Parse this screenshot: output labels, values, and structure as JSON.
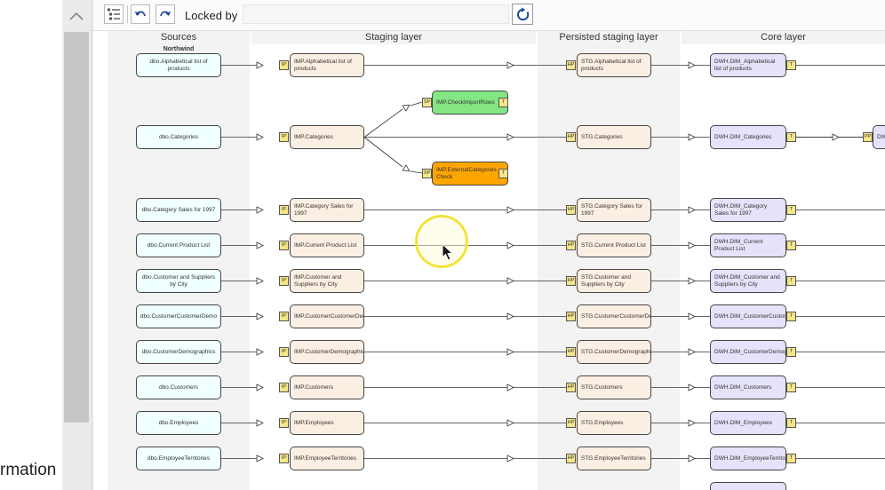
{
  "left_panel": {
    "partial_label": "rmation"
  },
  "toolbar": {
    "locked_label": "Locked by",
    "locked_value": ""
  },
  "columns": [
    {
      "label": "Sources"
    },
    {
      "label": "Staging layer"
    },
    {
      "label": "Persisted staging layer"
    },
    {
      "label": "Core layer"
    }
  ],
  "group_label": "Northwind",
  "rows": [
    {
      "source": "dbo.Alphabetical list of products",
      "imp": "IMP.Alphabetical list of products",
      "stg": "STG.Alphabetical list of products",
      "dwh": "DWH.DIM_Alphabetical list of products"
    },
    {
      "source": "dbo.Categories",
      "imp": "IMP.Categories",
      "stg": "STG.Categories",
      "dwh": "DWH.DIM_Categories"
    },
    {
      "source": "dbo.Category Sales for 1997",
      "imp": "IMP.Category Sales for 1997",
      "stg": "STG.Category Sales for 1997",
      "dwh": "DWH.DIM_Category Sales for 1997"
    },
    {
      "source": "dbo.Current Product List",
      "imp": "IMP.Current Product List",
      "stg": "STG.Current Product List",
      "dwh": "DWH.DIM_Current Product List"
    },
    {
      "source": "dbo.Customer and Suppliers by City",
      "imp": "IMP.Customer and Suppliers by City",
      "stg": "STG.Customer and Suppliers by City",
      "dwh": "DWH.DIM_Customer and Suppliers by City"
    },
    {
      "source": "dbo.CustomerCustomerDemo",
      "imp": "IMP.CustomerCustomerDemo",
      "stg": "STG.CustomerCustomerDemo",
      "dwh": "DWH.DIM_CustomerCustomerDemo"
    },
    {
      "source": "dbo.CustomerDemographics",
      "imp": "IMP.CustomerDemographics",
      "stg": "STG.CustomerDemographics",
      "dwh": "DWH.DIM_CustomerDemographics"
    },
    {
      "source": "dbo.Customers",
      "imp": "IMP.Customers",
      "stg": "STG.Customers",
      "dwh": "DWH.DIM_Customers"
    },
    {
      "source": "dbo.Employees",
      "imp": "IMP.Employees",
      "stg": "STG.Employees",
      "dwh": "DWH.DIM_Employees"
    },
    {
      "source": "dbo.EmployeeTerritories",
      "imp": "IMP.EmployeeTerritories",
      "stg": "STG.EmployeeTerritories",
      "dwh": "DWH.DIM_EmployeeTerritories"
    }
  ],
  "extra_nodes": {
    "check_import": "IMP.CheckImportRows",
    "external_check": "IMP.ExternalCategories Check",
    "dwh_partial": "DWH."
  },
  "badges": {
    "imp": "IP",
    "stg": "HP",
    "dwh": "T",
    "check_sp": "SP",
    "check_t": "T",
    "ext_xp": "XP",
    "ext_t": "T",
    "pp": "PP"
  },
  "colors": {
    "source_fill": "#f0ffff",
    "staging_fill": "#fbefe3",
    "core_fill": "#e4e3fb",
    "check_fill": "#83e683",
    "external_fill": "#ffa500",
    "badge_fill": "#f5e68a",
    "cursor_halo": "#f3e33b"
  }
}
